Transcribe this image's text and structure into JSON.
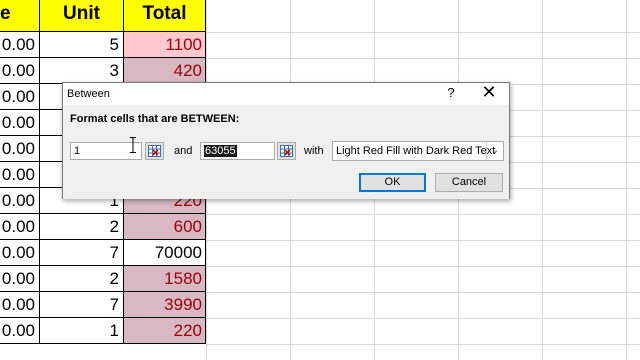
{
  "spreadsheet": {
    "headers": {
      "col1": "e",
      "col2": "Unit",
      "col3": "Total"
    },
    "rows": [
      {
        "c1": "0.00",
        "unit": "5",
        "total": "1100"
      },
      {
        "c1": "0.00",
        "unit": "3",
        "total": "420"
      },
      {
        "c1": "0.00",
        "unit": "",
        "total": ""
      },
      {
        "c1": "0.00",
        "unit": "",
        "total": ""
      },
      {
        "c1": "0.00",
        "unit": "",
        "total": ""
      },
      {
        "c1": "0.00",
        "unit": "",
        "total": ""
      },
      {
        "c1": "0.00",
        "unit": "1",
        "total": "220"
      },
      {
        "c1": "0.00",
        "unit": "2",
        "total": "600"
      },
      {
        "c1": "0.00",
        "unit": "7",
        "total": "70000"
      },
      {
        "c1": "0.00",
        "unit": "2",
        "total": "1580"
      },
      {
        "c1": "0.00",
        "unit": "7",
        "total": "3990"
      },
      {
        "c1": "0.00",
        "unit": "1",
        "total": "220"
      }
    ]
  },
  "dialog": {
    "title": "Between",
    "help": "?",
    "close": "✕",
    "prompt": "Format cells that are BETWEEN:",
    "value1": "1",
    "and_label": "and",
    "value2": "63055",
    "with_label": "with",
    "format_option": "Light Red Fill with Dark Red Text",
    "ok_label": "OK",
    "cancel_label": "Cancel"
  },
  "colors": {
    "header_fill": "#ffff00",
    "highlight_fill": "#ffc7ce",
    "highlight_text": "#9c0006",
    "selection_tint": "#d7b8c3",
    "ok_border": "#0078d7"
  },
  "icons": [
    "range-selector-icon",
    "dropdown-arrow-icon",
    "text-cursor-icon",
    "close-icon",
    "help-icon"
  ]
}
